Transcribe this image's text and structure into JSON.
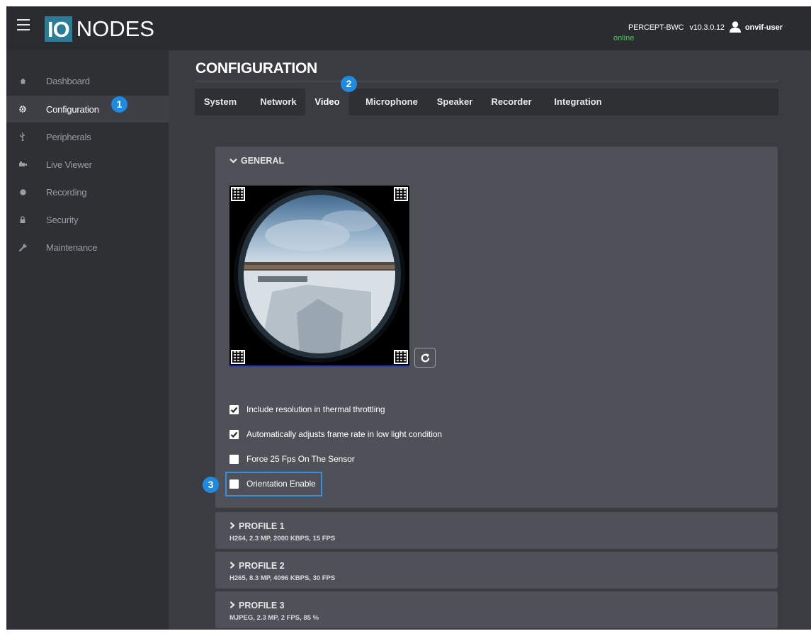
{
  "header": {
    "logo_io": "IO",
    "logo_nodes": "NODES",
    "device_name": "PERCEPT-BWC",
    "version": "v10.3.0.12",
    "user": "onvif-user",
    "status": "online"
  },
  "sidebar": {
    "items": [
      {
        "label": "Dashboard",
        "icon": "home-icon"
      },
      {
        "label": "Configuration",
        "icon": "gear-icon",
        "active": true
      },
      {
        "label": "Peripherals",
        "icon": "usb-icon"
      },
      {
        "label": "Live Viewer",
        "icon": "camera-icon"
      },
      {
        "label": "Recording",
        "icon": "record-icon"
      },
      {
        "label": "Security",
        "icon": "lock-icon"
      },
      {
        "label": "Maintenance",
        "icon": "wrench-icon"
      }
    ]
  },
  "page": {
    "title": "CONFIGURATION"
  },
  "tabs": [
    {
      "label": "System"
    },
    {
      "label": "Network"
    },
    {
      "label": "Video",
      "active": true
    },
    {
      "label": "Microphone"
    },
    {
      "label": "Speaker"
    },
    {
      "label": "Recorder"
    },
    {
      "label": "Integration"
    }
  ],
  "general": {
    "title": "GENERAL",
    "options": [
      {
        "label": "Include resolution in thermal throttling",
        "checked": true
      },
      {
        "label": "Automatically adjusts frame rate in low light condition",
        "checked": true
      },
      {
        "label": "Force 25 Fps On The Sensor",
        "checked": false
      },
      {
        "label": "Orientation Enable",
        "checked": false
      }
    ]
  },
  "profiles": [
    {
      "title": "PROFILE 1",
      "summary": "H264, 2.3 MP, 2000 KBPS, 15 FPS"
    },
    {
      "title": "PROFILE 2",
      "summary": "H265, 8.3 MP, 4096 KBPS, 30 FPS"
    },
    {
      "title": "PROFILE 3",
      "summary": "MJPEG, 2.3 MP, 2 FPS, 85 %"
    }
  ],
  "callouts": {
    "one": "1",
    "two": "2",
    "three": "3"
  },
  "colors": {
    "accent": "#2a7d96",
    "callout": "#1e8ae0",
    "online": "#4ccc5a",
    "highlight": "#3a8fdc"
  }
}
